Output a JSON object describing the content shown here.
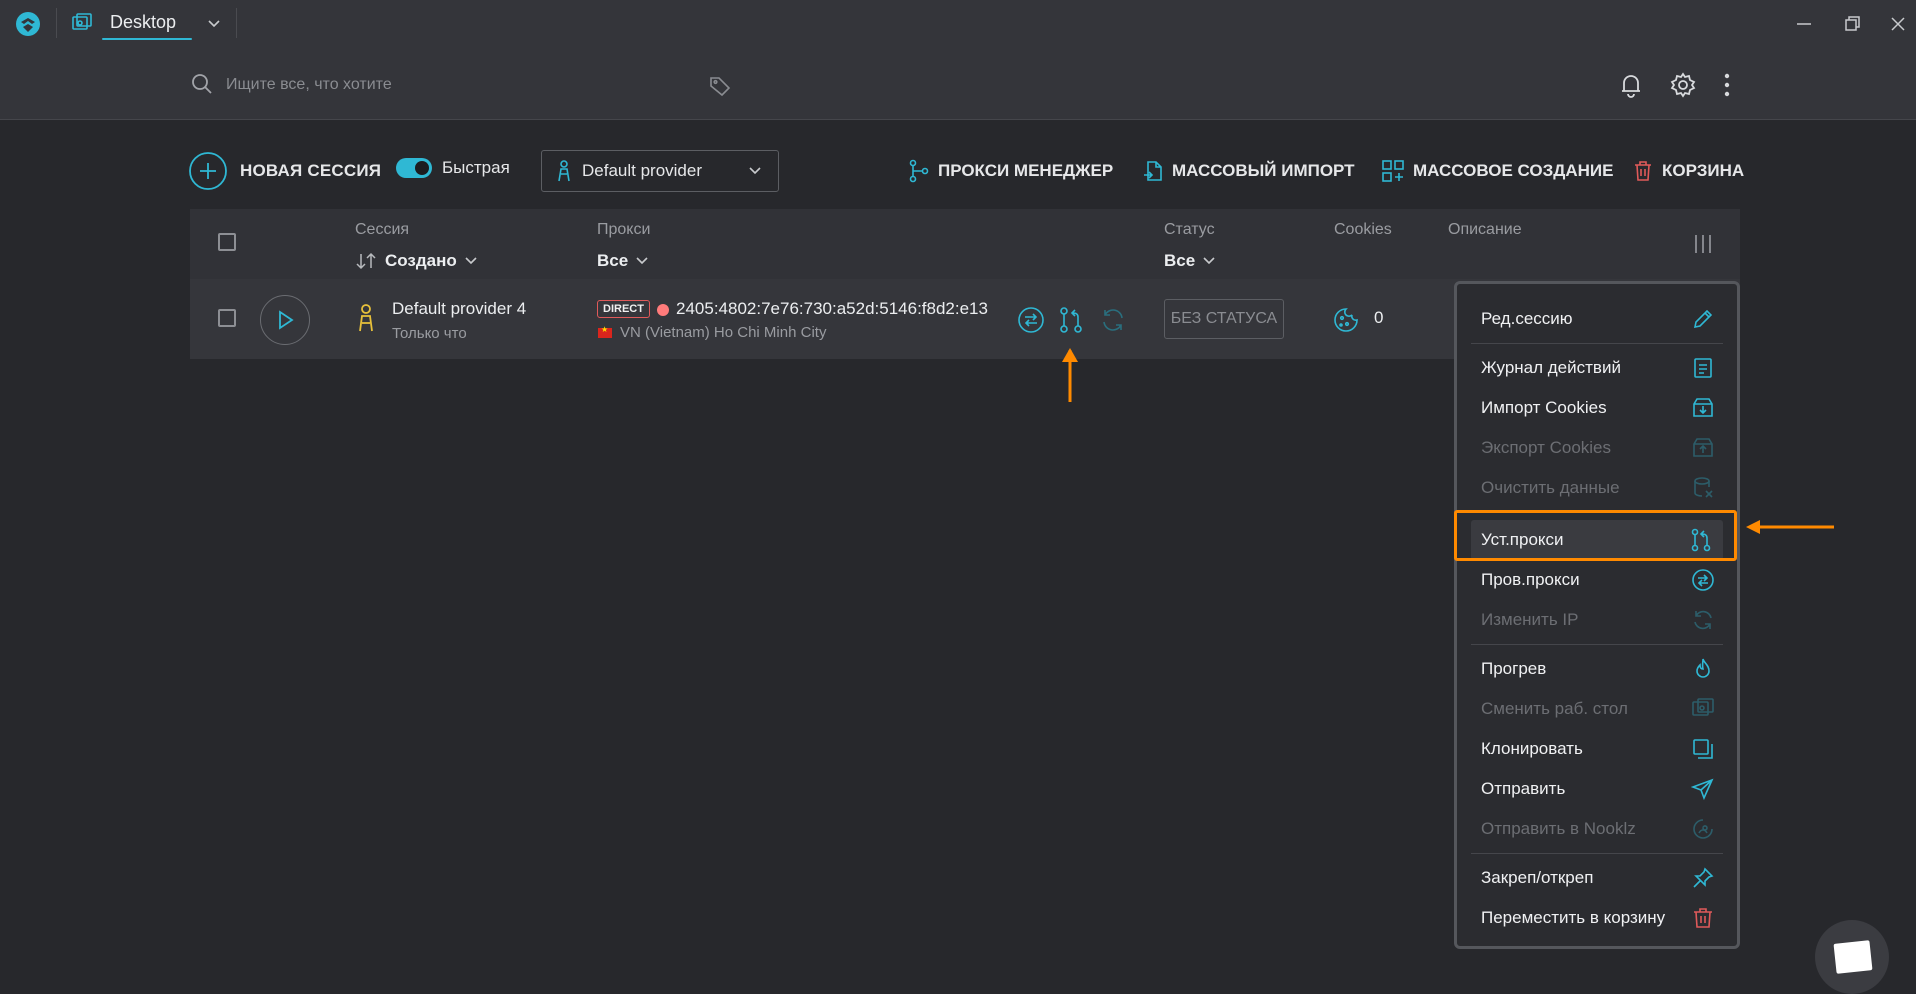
{
  "window": {
    "tab_label": "Desktop"
  },
  "header": {
    "search_placeholder": "Ищите все, что хотите"
  },
  "toolbar": {
    "new_session_label": "НОВАЯ СЕССИЯ",
    "quick_toggle_label": "Быстрая",
    "quick_toggle_on": true,
    "provider_selected": "Default provider",
    "proxy_manager_label": "ПРОКСИ МЕНЕДЖЕР",
    "mass_import_label": "МАССОВЫЙ ИМПОРТ",
    "mass_create_label": "МАССОВОЕ СОЗДАНИЕ",
    "trash_label": "КОРЗИНА"
  },
  "table": {
    "columns": {
      "session": "Сессия",
      "session_sort": "Создано",
      "proxy": "Прокси",
      "proxy_filter": "Все",
      "status": "Статус",
      "status_filter": "Все",
      "cookies": "Cookies",
      "description": "Описание"
    },
    "rows": [
      {
        "name": "Default provider 4",
        "created": "Только что",
        "proxy_type": "DIRECT",
        "proxy_ip": "2405:4802:7e76:730:a52d:5146:f8d2:e13",
        "proxy_location": "VN (Vietnam) Ho Chi Minh City",
        "status": "БЕЗ СТАТУСА",
        "cookies": "0"
      }
    ]
  },
  "context_menu": {
    "items": [
      {
        "label": "Ред.сессию",
        "icon": "pencil-icon",
        "enabled": true
      },
      {
        "label": "Журнал действий",
        "icon": "log-icon",
        "enabled": true
      },
      {
        "label": "Импорт Cookies",
        "icon": "import-box-icon",
        "enabled": true
      },
      {
        "label": "Экспорт Cookies",
        "icon": "export-box-icon",
        "enabled": false
      },
      {
        "label": "Очистить данные",
        "icon": "database-clear-icon",
        "enabled": false
      },
      {
        "label": "Уст.прокси",
        "icon": "proxy-connect-icon",
        "enabled": true,
        "active": true
      },
      {
        "label": "Пров.прокси",
        "icon": "check-proxy-icon",
        "enabled": true
      },
      {
        "label": "Изменить IP",
        "icon": "refresh-icon",
        "enabled": false
      },
      {
        "label": "Прогрев",
        "icon": "flame-icon",
        "enabled": true
      },
      {
        "label": "Сменить раб. стол",
        "icon": "desktop-switch-icon",
        "enabled": false
      },
      {
        "label": "Клонировать",
        "icon": "clone-icon",
        "enabled": true
      },
      {
        "label": "Отправить",
        "icon": "send-icon",
        "enabled": true
      },
      {
        "label": "Отправить в Nooklz",
        "icon": "send-nooklz-icon",
        "enabled": false
      },
      {
        "label": "Закреп/откреп",
        "icon": "pin-icon",
        "enabled": true
      },
      {
        "label": "Переместить в корзину",
        "icon": "trash-icon",
        "enabled": true
      }
    ]
  },
  "colors": {
    "accent": "#2fb8d4",
    "annotation": "#ff8a00",
    "danger": "#e05a5a",
    "background": "#27282c"
  }
}
